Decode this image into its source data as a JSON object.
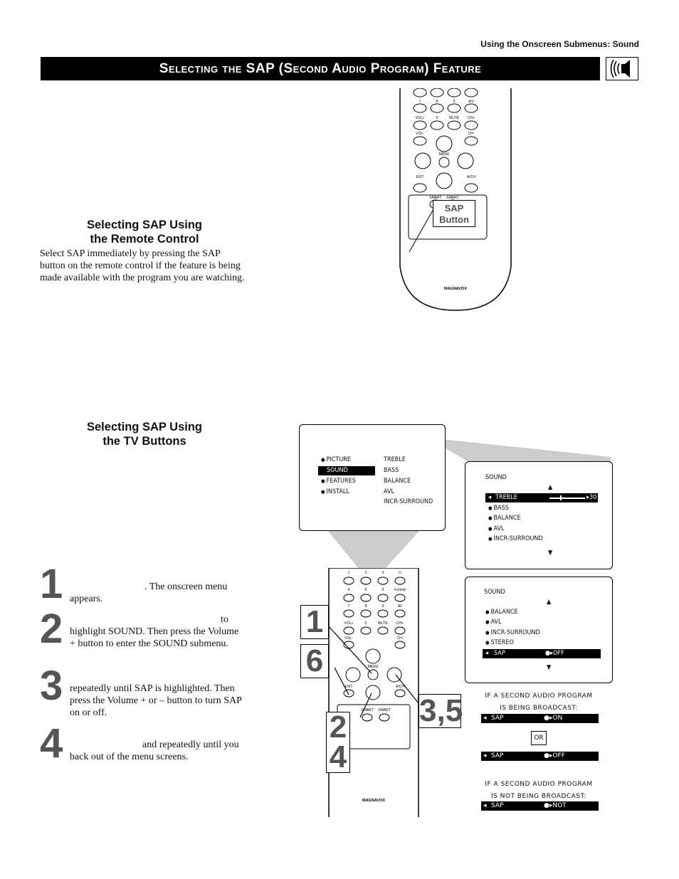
{
  "running_header": "Using the Onscreen Submenus: Sound",
  "title": "Selecting the SAP (Second Audio Program) Feature",
  "title_icon": "speaker-sound-icon",
  "section1": {
    "heading_line1": "Selecting SAP Using",
    "heading_line2": "the Remote Control",
    "body": "Select SAP immediately by pressing the SAP button on the remote control if the feature is being made available with the program you are watching.",
    "callout_line1": "SAP",
    "callout_line2": "Button"
  },
  "remote": {
    "brand": "MAGNAVOX",
    "top_rows": [
      [
        "7",
        "8",
        "9",
        "A/V"
      ],
      [
        "VOL+",
        "0",
        "MUTE",
        "CH+"
      ]
    ],
    "lower_rows": [
      [
        "1",
        "2",
        "3",
        "⏻"
      ],
      [
        "4",
        "5",
        "6",
        "Format"
      ],
      [
        "7",
        "8",
        "9",
        "AV"
      ],
      [
        "VOL+",
        "0",
        "MUTE",
        "CH+"
      ]
    ],
    "vol_minus": "VOL-",
    "ch_minus": "CH-",
    "menu": "MENU",
    "exit": "EXIT",
    "ach": "A/CH",
    "smart1": "SMART",
    "smart2": "SMART"
  },
  "section2": {
    "heading_line1": "Selecting SAP Using",
    "heading_line2": "the TV Buttons"
  },
  "steps": [
    {
      "num": "1",
      "text": ". The onscreen menu appears."
    },
    {
      "num": "2",
      "text": "to highlight SOUND. Then press the Volume + button to enter the SOUND submenu."
    },
    {
      "num": "3",
      "text": "repeatedly until SAP is highlighted. Then press the Volume + or – button to turn SAP on or off."
    },
    {
      "num": "4",
      "text": "and repeatedly until you back out of the menu screens."
    }
  ],
  "callout_numbers": [
    "1",
    "6",
    "3,5",
    "2",
    "4"
  ],
  "main_menu": {
    "left": [
      "PICTURE",
      "SOUND",
      "FEATURES",
      "INSTALL"
    ],
    "selected": "SOUND",
    "right": [
      "TREBLE",
      "BASS",
      "BALANCE",
      "AVL",
      "INCR-SURROUND"
    ]
  },
  "sound_menu_1": {
    "title": "SOUND",
    "selected": "TREBLE",
    "value": "30",
    "slider_percent": 30,
    "items": [
      "BASS",
      "BALANCE",
      "AVL",
      "INCR-SURROUND"
    ]
  },
  "sound_menu_2": {
    "title": "SOUND",
    "items": [
      "BALANCE",
      "AVL",
      "INCR-SURROUND",
      "STEREO"
    ],
    "selected": "SAP",
    "value": "OFF"
  },
  "results": {
    "caption1_line1": "IF A SECOND AUDIO PROGRAM",
    "caption1_line2": "IS BEING BROADCAST:",
    "bar_on_label": "SAP",
    "bar_on_value": "ON",
    "or": "OR",
    "bar_off_label": "SAP",
    "bar_off_value": "OFF",
    "caption2_line1": "IF A SECOND AUDIO PROGRAM",
    "caption2_line2": "IS NOT BEING BROADCAST:",
    "bar_na_label": "SAP",
    "bar_na_value": "NOT AVAILABLE"
  }
}
